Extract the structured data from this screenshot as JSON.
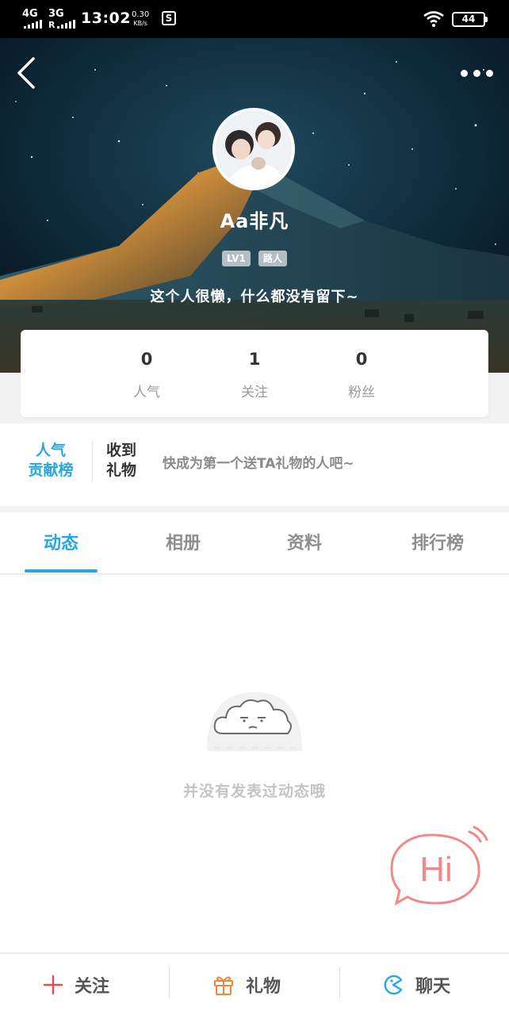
{
  "status_bar": {
    "network_1": "4G",
    "network_2": "3G",
    "network_2_sub": "R",
    "time": "13:02",
    "speed_value": "0.30",
    "speed_unit": "KB/s",
    "app_badge": "S",
    "battery": "44"
  },
  "profile": {
    "username": "Aa非凡",
    "level_badge": "LV1",
    "title_badge": "路人",
    "signature": "这个人很懒，什么都没有留下~"
  },
  "stats": [
    {
      "value": "0",
      "label": "人气"
    },
    {
      "value": "1",
      "label": "关注"
    },
    {
      "value": "0",
      "label": "粉丝"
    }
  ],
  "gift_section": {
    "rank_line1": "人气",
    "rank_line2": "贡献榜",
    "title_line1": "收到",
    "title_line2": "礼物",
    "hint": "快成为第一个送TA礼物的人吧~"
  },
  "tabs": [
    {
      "label": "动态",
      "active": true
    },
    {
      "label": "相册",
      "active": false
    },
    {
      "label": "资料",
      "active": false
    },
    {
      "label": "排行榜",
      "active": false
    }
  ],
  "empty_state": {
    "message": "并没有发表过动态哦"
  },
  "hi_button": {
    "label": "Hi"
  },
  "bottom_bar": {
    "follow_label": "关注",
    "gift_label": "礼物",
    "chat_label": "聊天"
  },
  "colors": {
    "accent": "#27a6df",
    "hi_pink": "#f08a8a",
    "follow_red": "#e84b4b",
    "gift_orange": "#f0883a"
  },
  "icons": [
    "back-arrow-icon",
    "more-dots-icon",
    "cloud-face-icon",
    "plus-icon",
    "gift-icon",
    "chat-icon",
    "wifi-icon",
    "battery-icon"
  ]
}
